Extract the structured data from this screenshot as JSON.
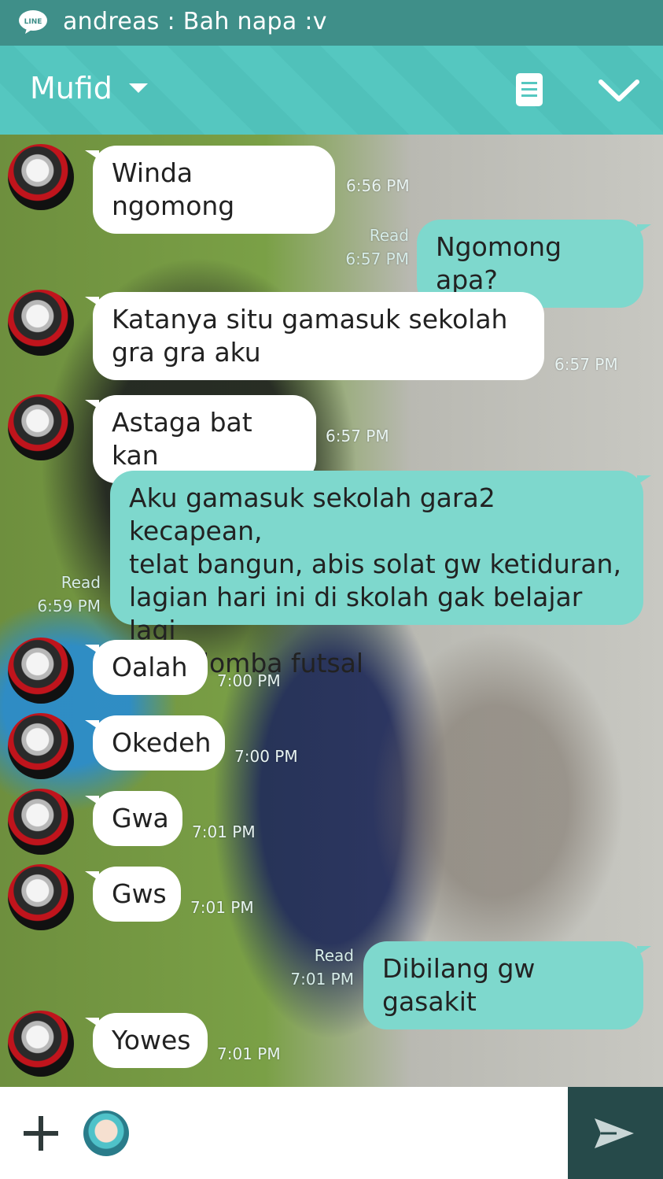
{
  "notification": {
    "app_icon": "line-app-icon",
    "text": "andreas : Bah napa :v"
  },
  "header": {
    "title": "Mufid",
    "notes_icon": "notes-icon",
    "collapse_icon": "chevron-down-icon"
  },
  "messages": [
    {
      "dir": "in",
      "text": "Winda ngomong",
      "time": "6:56 PM"
    },
    {
      "dir": "out",
      "text": "Ngomong apa?",
      "status": "Read",
      "time": "6:57 PM"
    },
    {
      "dir": "in",
      "text": "Katanya situ gamasuk sekolah\ngra gra aku",
      "time": "6:57 PM"
    },
    {
      "dir": "in",
      "text": "Astaga bat kan",
      "time": "6:57 PM"
    },
    {
      "dir": "out",
      "text": "Aku gamasuk sekolah gara2 kecapean,\ntelat bangun, abis solat gw ketiduran,\nlagian hari ini di skolah gak belajar lagi\npada lomba futsal",
      "status": "Read",
      "time": "6:59 PM"
    },
    {
      "dir": "in",
      "text": "Oalah",
      "time": "7:00 PM"
    },
    {
      "dir": "in",
      "text": "Okedeh",
      "time": "7:00 PM"
    },
    {
      "dir": "in",
      "text": "Gwa",
      "time": "7:01 PM"
    },
    {
      "dir": "in",
      "text": "Gws",
      "time": "7:01 PM"
    },
    {
      "dir": "out",
      "text": "Dibilang gw gasakit",
      "status": "Read",
      "time": "7:01 PM"
    },
    {
      "dir": "in",
      "text": "Yowes",
      "time": "7:01 PM"
    }
  ],
  "composer": {
    "plus_icon": "plus-icon",
    "sticker_icon": "sticker-icon",
    "placeholder": "",
    "send_icon": "send-icon"
  },
  "colors": {
    "header": "#55c7c0",
    "notification_bar": "#3f8f89",
    "outgoing_bubble": "#7ed8cd",
    "incoming_bubble": "#ffffff",
    "send_button": "#264a4a"
  }
}
